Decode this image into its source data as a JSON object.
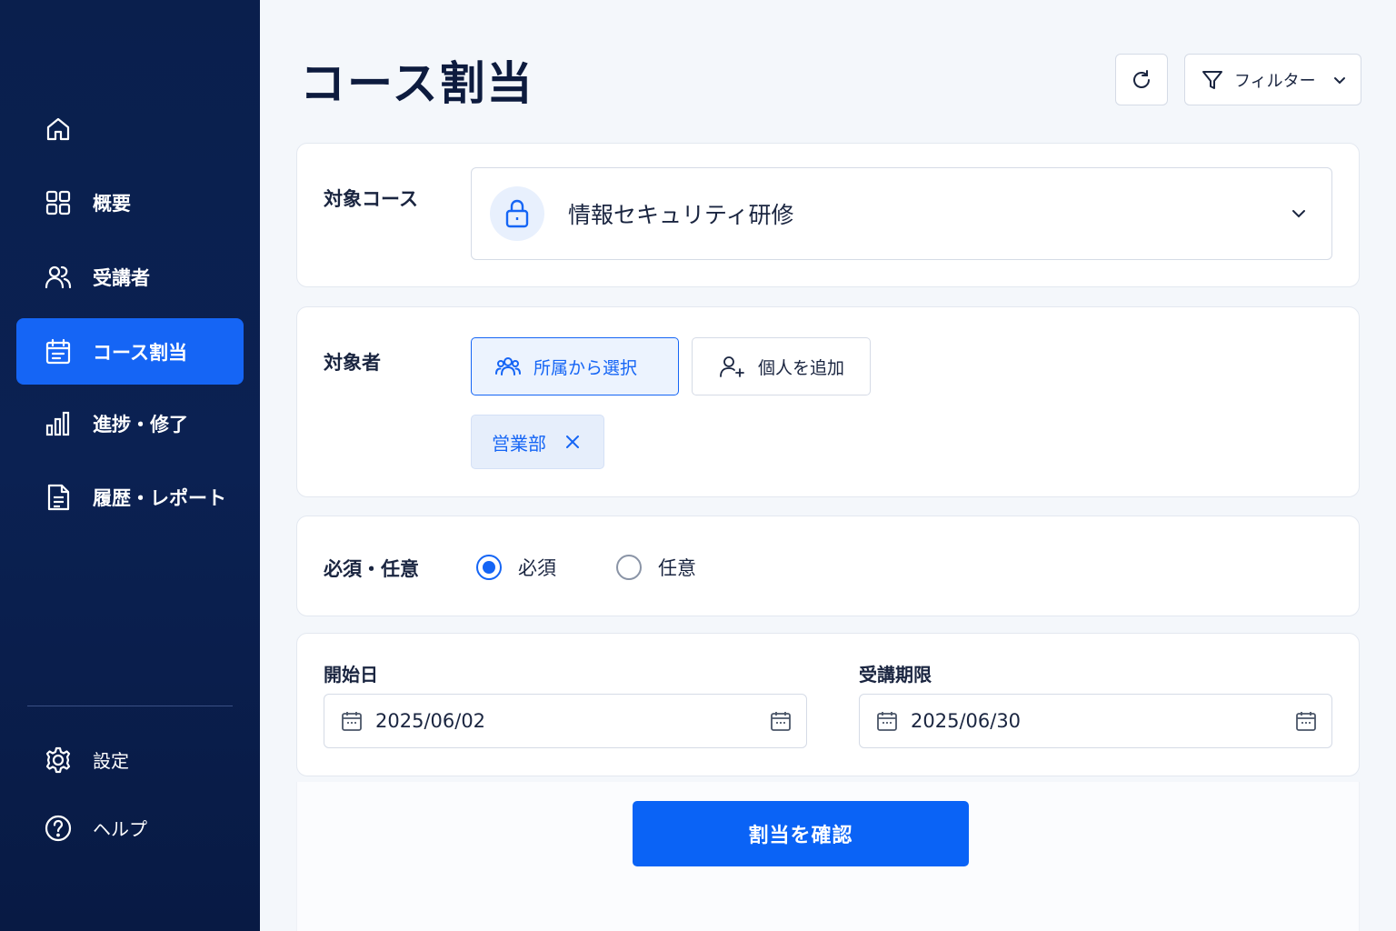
{
  "colors": {
    "sidebar": "#0a1f4d",
    "accent": "#1565f5",
    "background": "#f4f7fb"
  },
  "sidebar": {
    "items": [
      {
        "label": "",
        "icon": "home-icon"
      },
      {
        "label": "概要",
        "icon": "grid-icon"
      },
      {
        "label": "受講者",
        "icon": "users-icon"
      },
      {
        "label": "コース割当",
        "icon": "calendar-icon",
        "active": true
      },
      {
        "label": "進捗・修了",
        "icon": "bar-chart-icon"
      },
      {
        "label": "履歴・レポート",
        "icon": "document-icon"
      }
    ],
    "bottom": [
      {
        "label": "設定",
        "icon": "gear-icon"
      },
      {
        "label": "ヘルプ",
        "icon": "help-icon"
      }
    ]
  },
  "header": {
    "title": "コース割当",
    "filter_label": "フィルター"
  },
  "course": {
    "label": "対象コース",
    "selected": "情報セキュリティ研修"
  },
  "target": {
    "label": "対象者",
    "by_affiliation": "所属から選択",
    "add_individual": "個人を追加",
    "chips": [
      "営業部"
    ]
  },
  "requirement": {
    "label": "必須・任意",
    "options": [
      "必須",
      "任意"
    ],
    "selected": "必須"
  },
  "dates": {
    "start_label": "開始日",
    "start_value": "2025/06/02",
    "deadline_label": "受講期限",
    "deadline_value": "2025/06/30"
  },
  "confirm_label": "割当を確認"
}
